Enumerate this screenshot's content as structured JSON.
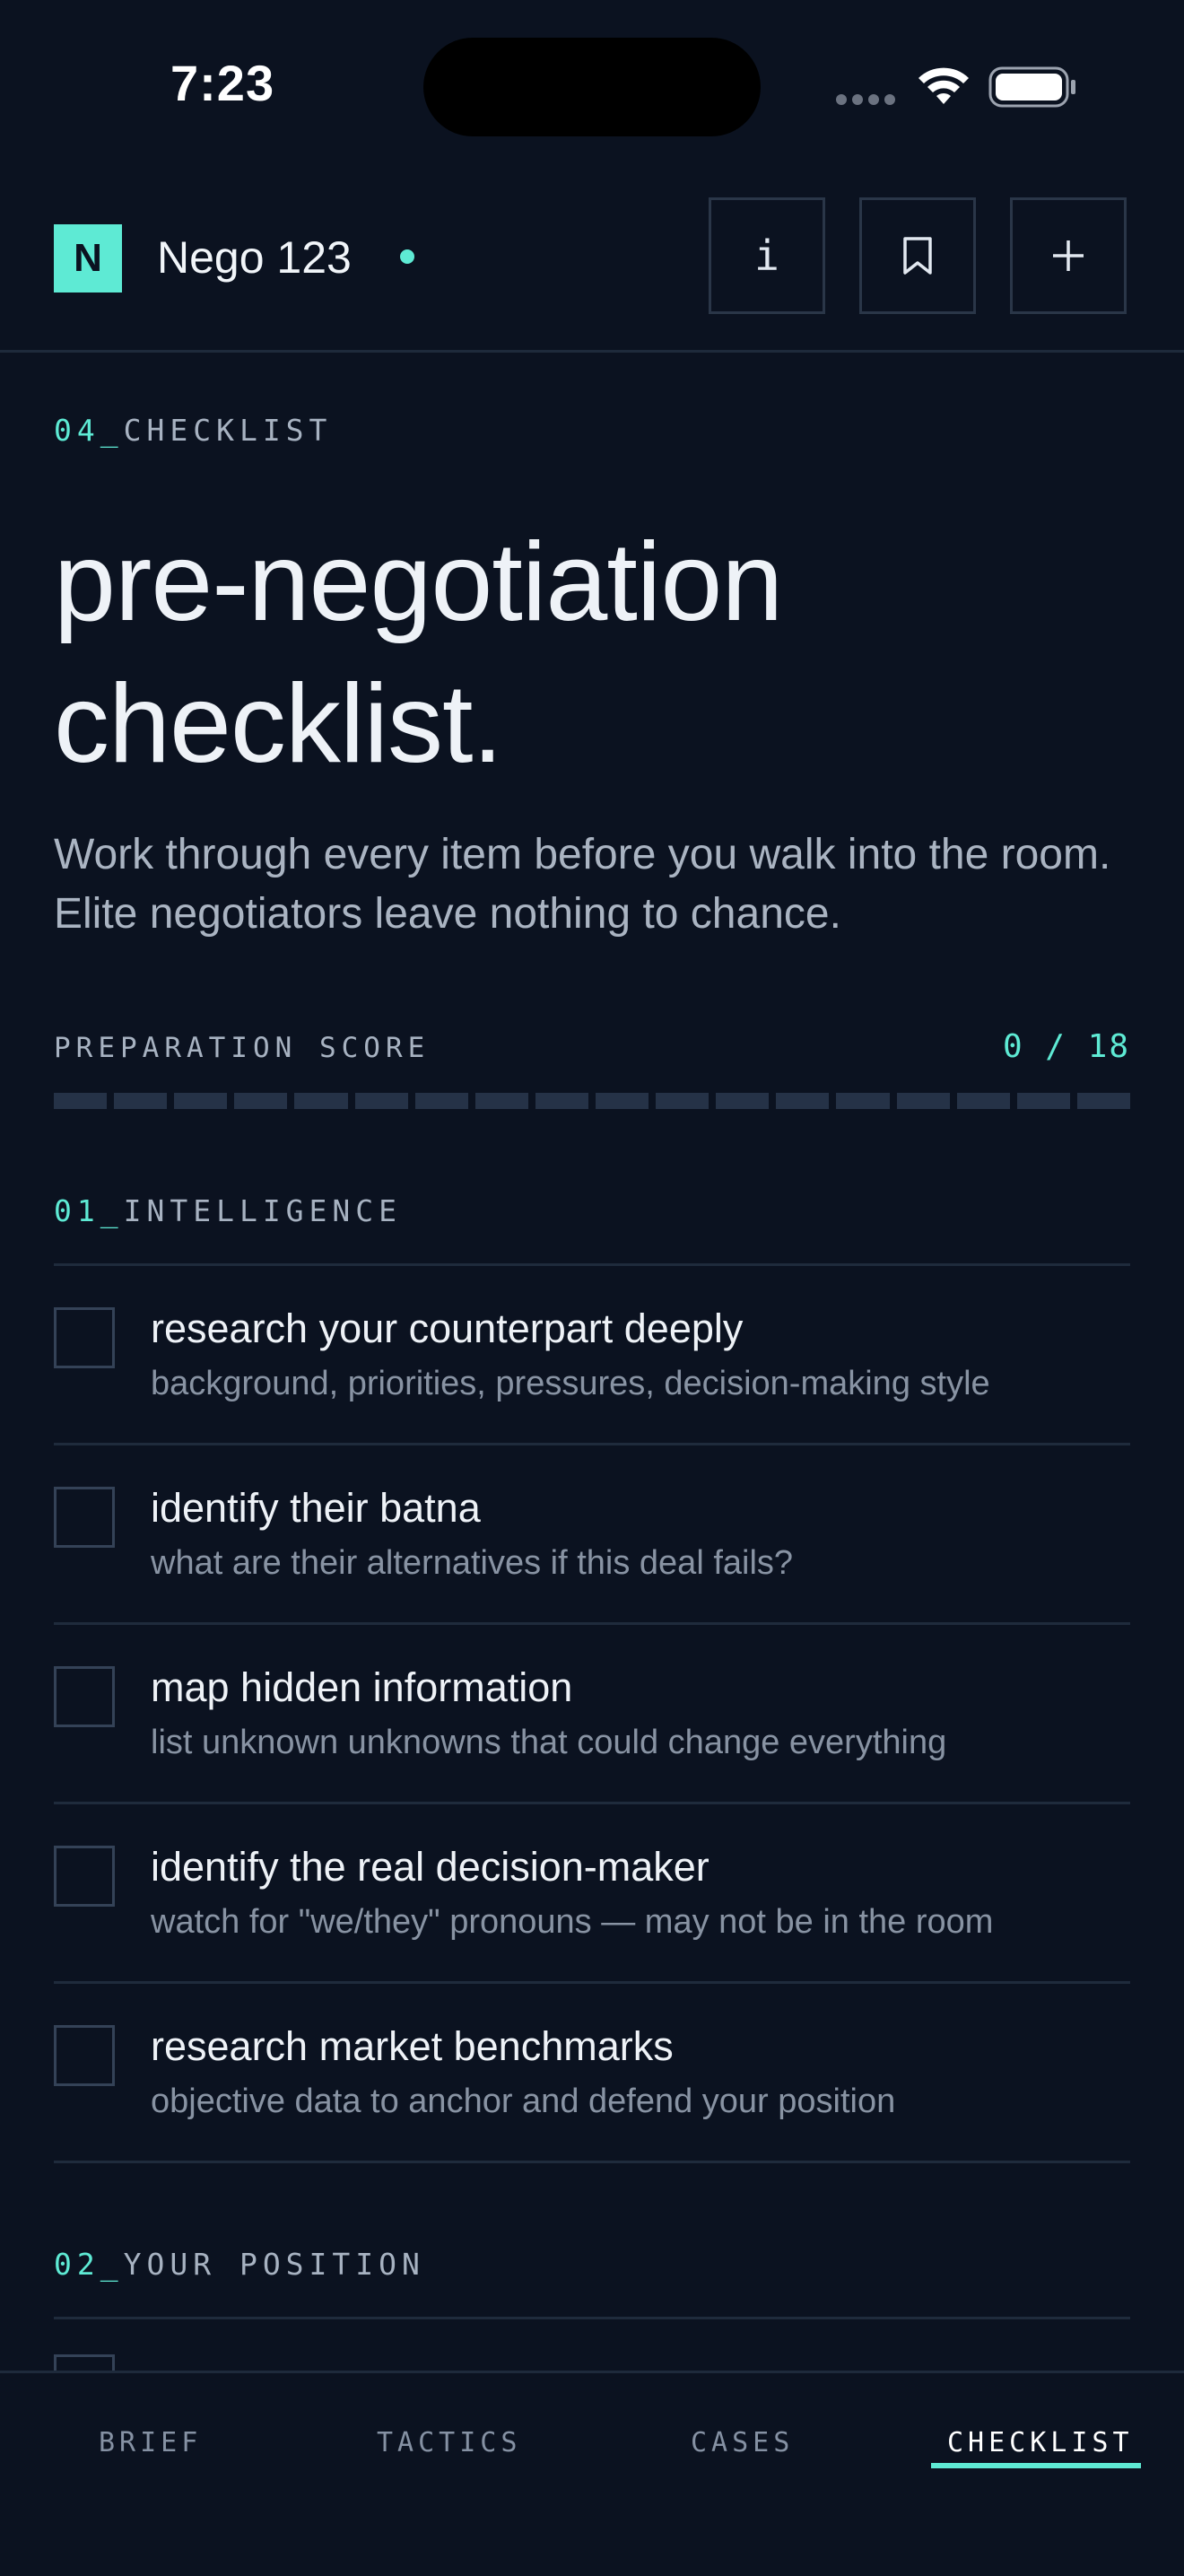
{
  "status_bar": {
    "time": "7:23"
  },
  "header": {
    "logo_letter": "N",
    "title": "Nego 123",
    "info_label": "i"
  },
  "page": {
    "section_number": "04_",
    "section_name": "CHECKLIST",
    "title_line1": "pre-negotiation",
    "title_line2": "checklist.",
    "intro": "Work through every item before you walk into the room. Elite negotiators leave nothing to chance."
  },
  "score": {
    "label": "PREPARATION SCORE",
    "value": "0 / 18",
    "completed": 0,
    "total": 18
  },
  "groups": [
    {
      "number": "01_",
      "name": "INTELLIGENCE",
      "items": [
        {
          "title": "research your counterpart deeply",
          "subtitle": "background, priorities, pressures, decision-making style",
          "checked": false
        },
        {
          "title": "identify their batna",
          "subtitle": "what are their alternatives if this deal fails?",
          "checked": false
        },
        {
          "title": "map hidden information",
          "subtitle": "list unknown unknowns that could change everything",
          "checked": false
        },
        {
          "title": "identify the real decision-maker",
          "subtitle": "watch for \"we/they\" pronouns — may not be in the room",
          "checked": false
        },
        {
          "title": "research market benchmarks",
          "subtitle": "objective data to anchor and defend your position",
          "checked": false
        }
      ]
    },
    {
      "number": "02_",
      "name": "YOUR POSITION"
    }
  ],
  "bottom_nav": {
    "tabs": [
      "BRIEF",
      "TACTICS",
      "CASES",
      "CHECKLIST"
    ],
    "active": "CHECKLIST"
  },
  "colors": {
    "background": "#0b1220",
    "accent": "#5eead4",
    "muted_text": "#8893a3",
    "border": "#1f2b3c"
  }
}
